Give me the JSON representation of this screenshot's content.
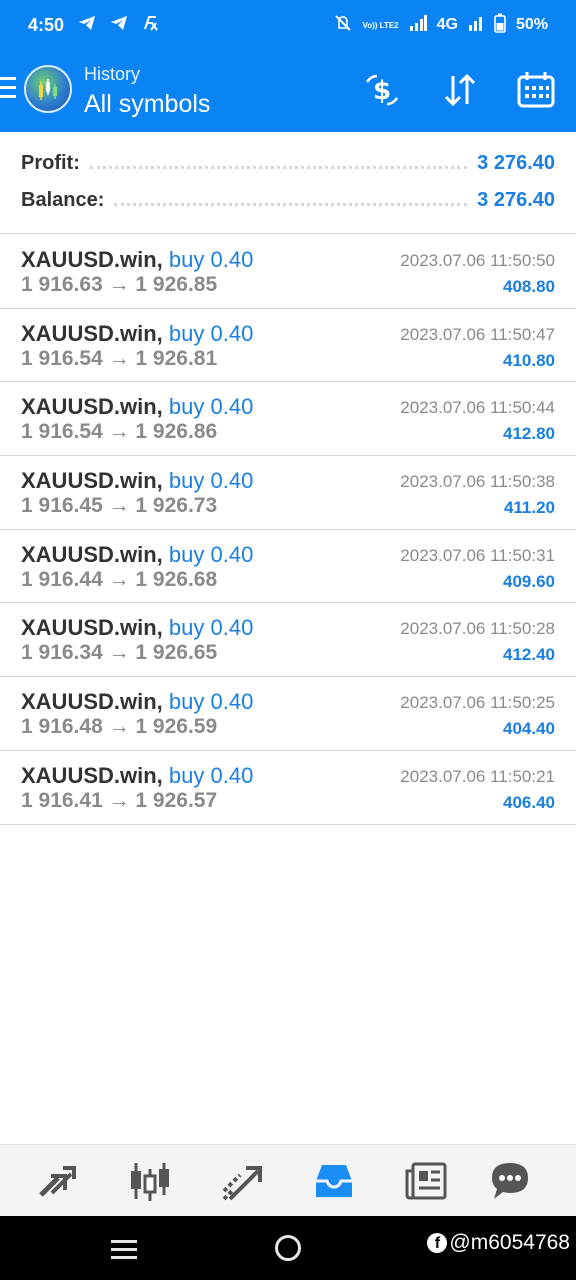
{
  "status_bar": {
    "time": "4:50",
    "network": "4G",
    "volte": "Vo)) LTE2",
    "battery": "50%"
  },
  "app_bar": {
    "subtitle": "History",
    "title": "All symbols"
  },
  "summary": {
    "profit_label": "Profit:",
    "profit_value": "3 276.40",
    "balance_label": "Balance:",
    "balance_value": "3 276.40"
  },
  "trades": [
    {
      "symbol": "XAUUSD.win,",
      "direction": "buy 0.40",
      "prices": "1 916.63 → 1 926.85",
      "time": "2023.07.06 11:50:50",
      "profit": "408.80"
    },
    {
      "symbol": "XAUUSD.win,",
      "direction": "buy 0.40",
      "prices": "1 916.54 → 1 926.81",
      "time": "2023.07.06 11:50:47",
      "profit": "410.80"
    },
    {
      "symbol": "XAUUSD.win,",
      "direction": "buy 0.40",
      "prices": "1 916.54 → 1 926.86",
      "time": "2023.07.06 11:50:44",
      "profit": "412.80"
    },
    {
      "symbol": "XAUUSD.win,",
      "direction": "buy 0.40",
      "prices": "1 916.45 → 1 926.73",
      "time": "2023.07.06 11:50:38",
      "profit": "411.20"
    },
    {
      "symbol": "XAUUSD.win,",
      "direction": "buy 0.40",
      "prices": "1 916.44 → 1 926.68",
      "time": "2023.07.06 11:50:31",
      "profit": "409.60"
    },
    {
      "symbol": "XAUUSD.win,",
      "direction": "buy 0.40",
      "prices": "1 916.34 → 1 926.65",
      "time": "2023.07.06 11:50:28",
      "profit": "412.40"
    },
    {
      "symbol": "XAUUSD.win,",
      "direction": "buy 0.40",
      "prices": "1 916.48 → 1 926.59",
      "time": "2023.07.06 11:50:25",
      "profit": "404.40"
    },
    {
      "symbol": "XAUUSD.win,",
      "direction": "buy 0.40",
      "prices": "1 916.41 → 1 926.57",
      "time": "2023.07.06 11:50:21",
      "profit": "406.40"
    }
  ],
  "bottom_nav": [
    "quotes-icon",
    "chart-icon",
    "trade-icon",
    "history-icon",
    "news-icon",
    "chat-icon"
  ],
  "watermark": "@m6054768",
  "colors": {
    "accent": "#0a84f5",
    "value_blue": "#1a7fe0",
    "muted": "#8a8a8a"
  }
}
